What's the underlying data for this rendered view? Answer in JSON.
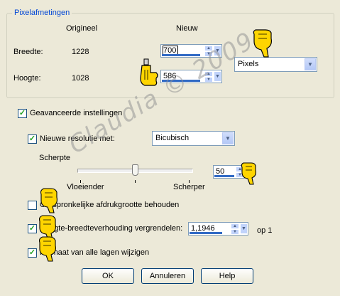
{
  "group": {
    "title": "Pixelafmetingen"
  },
  "columns": {
    "original": "Origineel",
    "new": "Nieuw"
  },
  "width": {
    "label": "Breedte:",
    "original": "1228",
    "new": "700"
  },
  "height": {
    "label": "Hoogte:",
    "original": "1028",
    "new": "586"
  },
  "unit": {
    "selected": "Pixels"
  },
  "advanced": {
    "label": "Geavanceerde instellingen",
    "checked": true
  },
  "resolution": {
    "label": "Nieuwe resolutie met:",
    "method": "Bicubisch",
    "checked": true
  },
  "sharpness": {
    "label": "Scherpte",
    "value": "50",
    "left_label": "Vloeiender",
    "right_label": "Scherper",
    "level": 0.5
  },
  "keep_print_size": {
    "label": "Oorspronkelijke afdrukgrootte behouden",
    "checked": false
  },
  "lock_aspect": {
    "label": "Hoogte-breedteverhouding vergrendelen:",
    "ratio": "1,1946",
    "suffix": "op 1",
    "checked": true
  },
  "resize_layers": {
    "label": "Formaat van alle lagen wijzigen",
    "checked": true
  },
  "buttons": {
    "ok": "OK",
    "cancel": "Annuleren",
    "help": "Help"
  },
  "watermark": {
    "text": "Claudia © 2009"
  },
  "icons": {
    "pointer": "pointing-hand-icon",
    "check": "checkmark-icon",
    "spin": "spin-arrows-icon",
    "dropdown": "chevron-down-icon"
  }
}
